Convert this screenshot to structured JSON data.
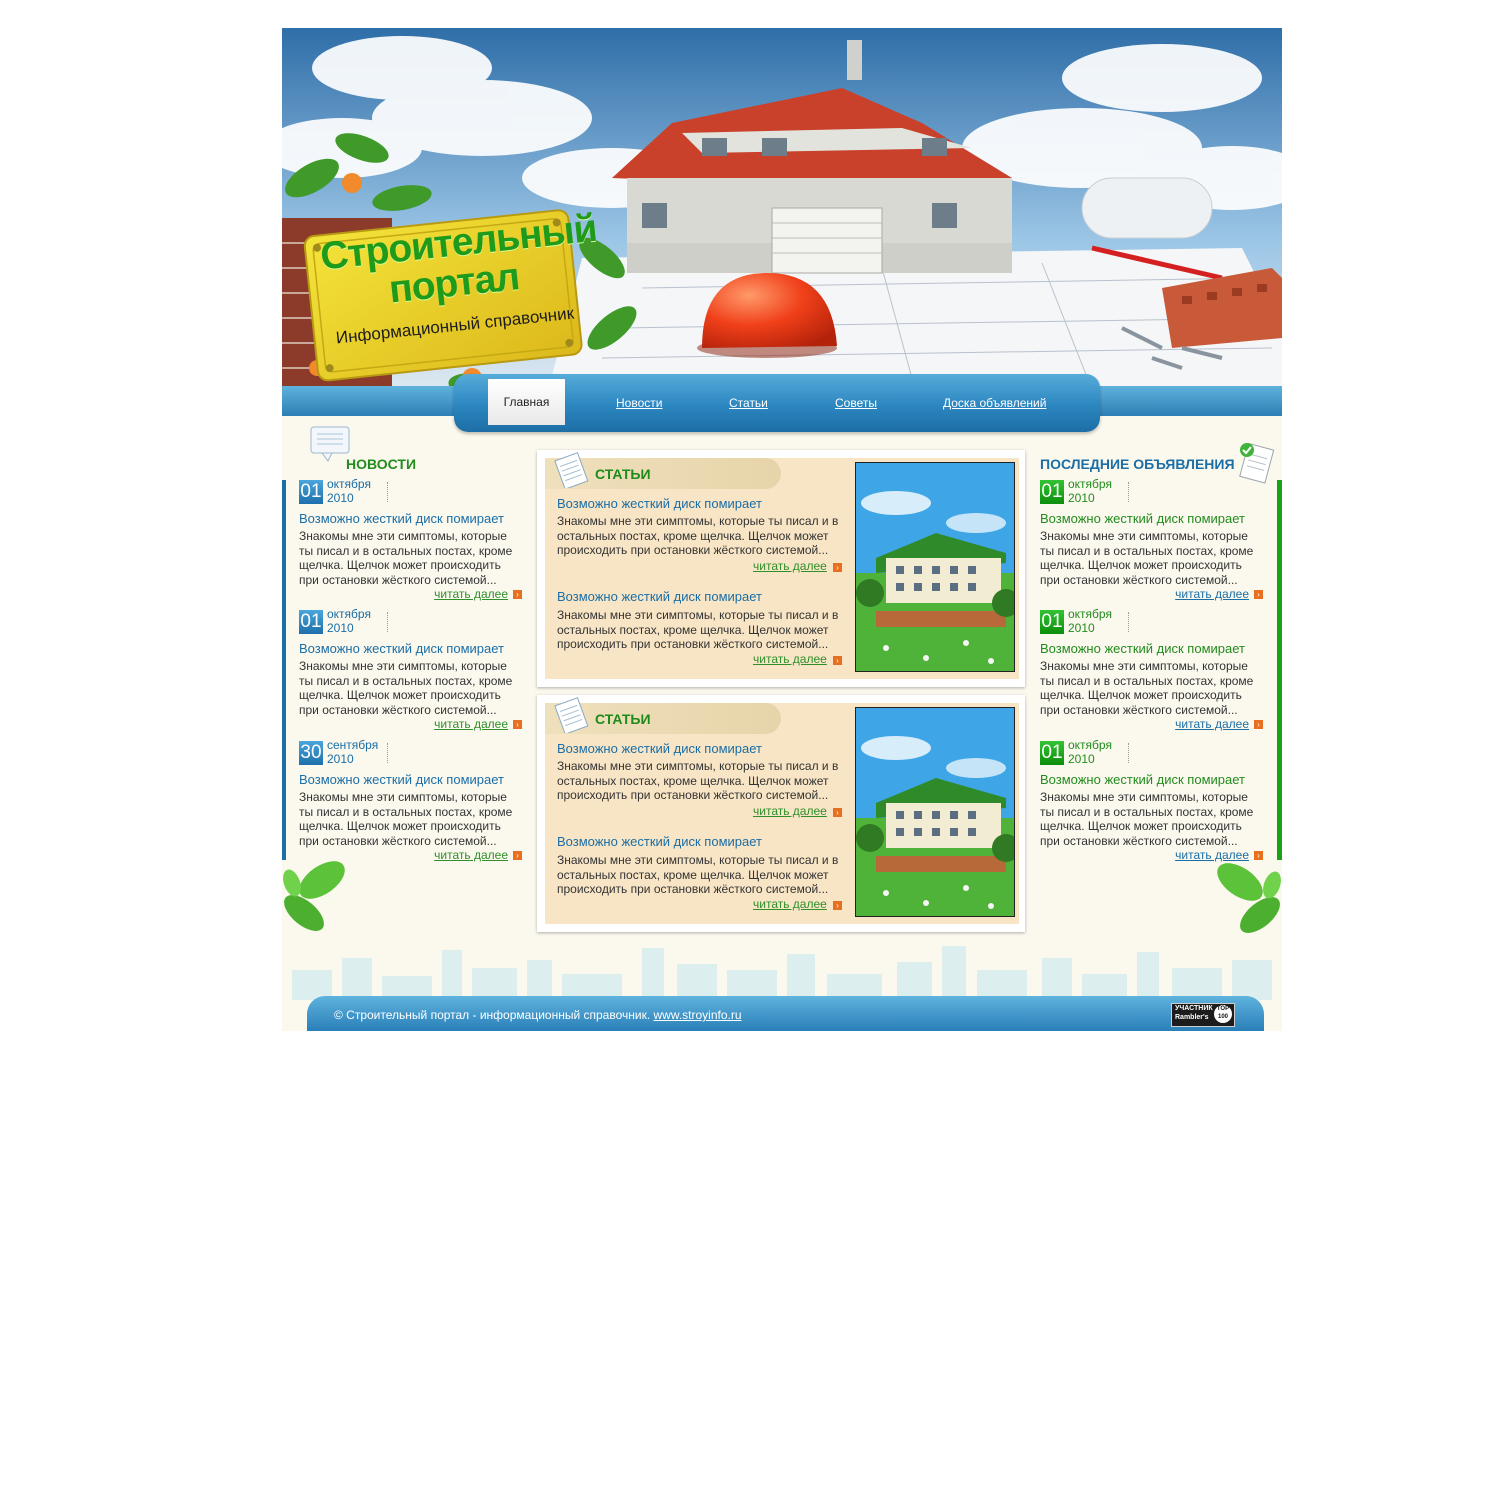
{
  "logo": {
    "title_line1": "Строительный",
    "title_line2": "портал",
    "subtitle": "Информационный справочник"
  },
  "nav": {
    "items": [
      "Главная",
      "Новости",
      "Статьи",
      "Советы",
      "Доска объявлений"
    ],
    "active": "Главная"
  },
  "news": {
    "title": "НОВОСТИ",
    "items": [
      {
        "day": "01",
        "month": "октября",
        "year": "2010",
        "title": "Возможно жесткий диск помирает",
        "text": "Знакомы мне эти симптомы, которые ты писал и в остальных постах, кроме щелчка. Щелчок может происходить при остановки жёсткого системой...",
        "more": "читать далее"
      },
      {
        "day": "01",
        "month": "октября",
        "year": "2010",
        "title": "Возможно жесткий диск помирает",
        "text": "Знакомы мне эти симптомы, которые ты писал и в остальных постах, кроме щелчка. Щелчок может происходить при остановки жёсткого системой...",
        "more": "читать далее"
      },
      {
        "day": "30",
        "month": "сентября",
        "year": "2010",
        "title": "Возможно жесткий диск помирает",
        "text": "Знакомы мне эти симптомы, которые ты писал и в остальных постах, кроме щелчка. Щелчок может происходить при остановки жёсткого системой...",
        "more": "читать далее"
      }
    ]
  },
  "articles": {
    "blocks": [
      {
        "label": "СТАТЬИ",
        "items": [
          {
            "title": "Возможно жесткий диск помирает",
            "text": "Знакомы мне эти симптомы, которые ты писал и в остальных постах, кроме щелчка. Щелчок может происходить при остановки жёсткого системой...",
            "more": "читать далее"
          },
          {
            "title": "Возможно жесткий диск помирает",
            "text": "Знакомы мне эти симптомы, которые ты писал и в остальных постах, кроме щелчка. Щелчок может происходить при остановки жёсткого системой...",
            "more": "читать далее"
          }
        ]
      },
      {
        "label": "СТАТЬИ",
        "items": [
          {
            "title": "Возможно жесткий диск помирает",
            "text": "Знакомы мне эти симптомы, которые ты писал и в остальных постах, кроме щелчка. Щелчок может происходить при остановки жёсткого системой...",
            "more": "читать далее"
          },
          {
            "title": "Возможно жесткий диск помирает",
            "text": "Знакомы мне эти симптомы, которые ты писал и в остальных постах, кроме щелчка. Щелчок может происходить при остановки жёсткого системой...",
            "more": "читать далее"
          }
        ]
      }
    ]
  },
  "ads": {
    "title": "ПОСЛЕДНИЕ ОБЪЯВЛЕНИЯ",
    "items": [
      {
        "day": "01",
        "month": "октября",
        "year": "2010",
        "title": "Возможно жесткий диск помирает",
        "text": "Знакомы мне эти симптомы, которые ты писал и в остальных постах, кроме щелчка. Щелчок может происходить при остановки жёсткого системой...",
        "more": "читать далее"
      },
      {
        "day": "01",
        "month": "октября",
        "year": "2010",
        "title": "Возможно жесткий диск помирает",
        "text": "Знакомы мне эти симптомы, которые ты писал и в остальных постах, кроме щелчка. Щелчок может происходить при остановки жёсткого системой...",
        "more": "читать далее"
      },
      {
        "day": "01",
        "month": "октября",
        "year": "2010",
        "title": "Возможно жесткий диск помирает",
        "text": "Знакомы мне эти симптомы, которые ты писал и в остальных постах, кроме щелчка. Щелчок может происходить при остановки жёсткого системой...",
        "more": "читать далее"
      }
    ]
  },
  "footer": {
    "copyright": "© Строительный портал - информационный справочник.",
    "link": "www.stroyinfo.ru",
    "counter_line1": "УЧАСТНИК",
    "counter_line2": "Rambler's",
    "counter_badge": "TOP 100"
  },
  "icons": {
    "news": "speech-bubble-icon",
    "articles": "notepad-icon",
    "ads": "checklist-icon",
    "more": "arrow-right-icon"
  },
  "colors": {
    "blue": "#1b6ea6",
    "green": "#228c1d",
    "background": "#fbf8ee",
    "article_bg": "#f8e5c5"
  }
}
